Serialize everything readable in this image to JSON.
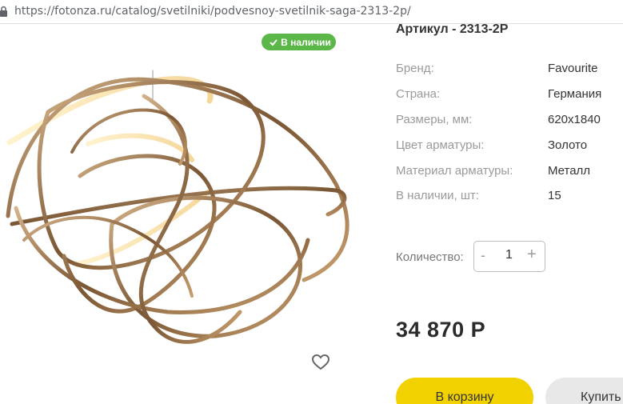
{
  "browser": {
    "url": "https://fotonza.ru/catalog/svetilniki/podvesnoy-svetilnik-saga-2313-2p/"
  },
  "product": {
    "stock_badge": "В наличии",
    "article": "Артикул - 2313-2P",
    "specs": [
      {
        "label": "Бренд:",
        "value": "Favourite"
      },
      {
        "label": "Страна:",
        "value": "Германия"
      },
      {
        "label": "Размеры, мм:",
        "value": "620x1840"
      },
      {
        "label": "Цвет арматуры:",
        "value": "Золото"
      },
      {
        "label": "Материал арматуры:",
        "value": "Металл"
      },
      {
        "label": "В наличии, шт:",
        "value": "15"
      }
    ],
    "quantity": {
      "label": "Количество:",
      "minus": "-",
      "value": "1",
      "plus": "+"
    },
    "price": "34 870 Р",
    "cart_button": "В корзину",
    "buy_button": "Купить"
  },
  "colors": {
    "badge": "#5ab748",
    "cart": "#f2d100",
    "buy": "#e8e8e8",
    "gold": "#a87f4f"
  },
  "icons": {
    "lock": "lock-icon",
    "check": "check-icon",
    "heart": "heart-icon"
  }
}
